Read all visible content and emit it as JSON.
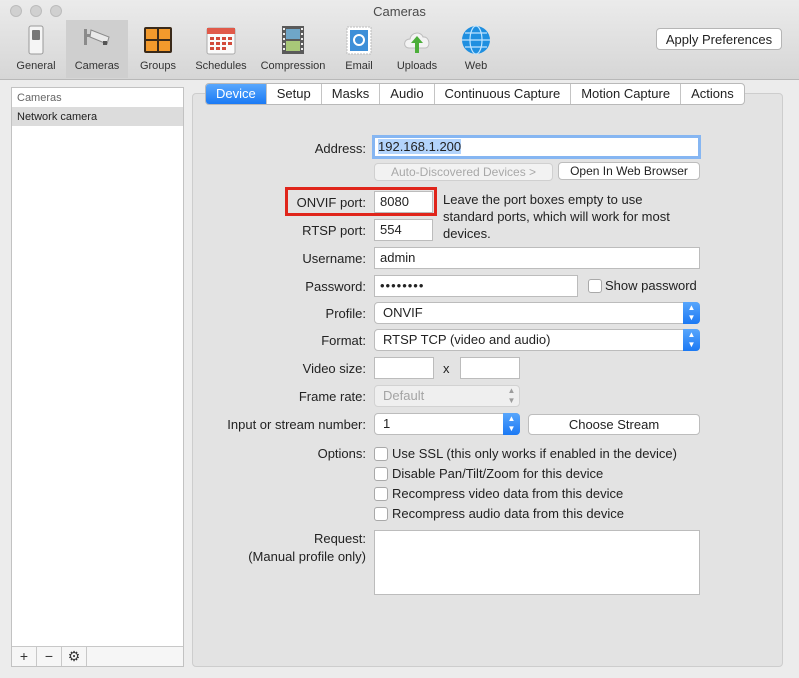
{
  "window": {
    "title": "Cameras"
  },
  "toolbar": {
    "items": [
      {
        "label": "General"
      },
      {
        "label": "Cameras"
      },
      {
        "label": "Groups"
      },
      {
        "label": "Schedules"
      },
      {
        "label": "Compression"
      },
      {
        "label": "Email"
      },
      {
        "label": "Uploads"
      },
      {
        "label": "Web"
      }
    ],
    "apply_label": "Apply Preferences"
  },
  "sidebar": {
    "header": "Cameras",
    "items": [
      {
        "label": "Network camera"
      }
    ],
    "footer": {
      "add": "+",
      "remove": "−",
      "settings": "⚙"
    }
  },
  "tabs": [
    "Device",
    "Setup",
    "Masks",
    "Audio",
    "Continuous Capture",
    "Motion Capture",
    "Actions"
  ],
  "form": {
    "address_label": "Address:",
    "address_value": "192.168.1.200",
    "auto_discovered_label": "Auto-Discovered Devices >",
    "open_browser_label": "Open In Web Browser",
    "onvif_label": "ONVIF port:",
    "onvif_value": "8080",
    "rtsp_label": "RTSP port:",
    "rtsp_value": "554",
    "port_hint": "Leave the port boxes empty to use standard ports, which will work for most devices.",
    "username_label": "Username:",
    "username_value": "admin",
    "password_label": "Password:",
    "password_value": "••••••••",
    "show_password_label": "Show password",
    "profile_label": "Profile:",
    "profile_value": "ONVIF",
    "format_label": "Format:",
    "format_value": "RTSP TCP (video and audio)",
    "video_size_label": "Video size:",
    "video_size_x": "x",
    "frame_rate_label": "Frame rate:",
    "frame_rate_value": "Default",
    "input_stream_label": "Input or stream number:",
    "input_stream_value": "1",
    "choose_stream_label": "Choose Stream",
    "options_label": "Options:",
    "options": [
      "Use SSL (this only works if enabled in the device)",
      "Disable Pan/Tilt/Zoom for this device",
      "Recompress video data from this device",
      "Recompress audio data from this device"
    ],
    "request_label_1": "Request:",
    "request_label_2": "(Manual profile only)"
  },
  "colors": {
    "accent": "#1a7af5",
    "highlight_box": "#e0251b"
  },
  "icons": {
    "general": "switch-icon",
    "cameras": "security-camera-icon",
    "groups": "grid-icon",
    "schedules": "calendar-icon",
    "compression": "film-icon",
    "email": "stamp-icon",
    "uploads": "cloud-upload-icon",
    "web": "globe-icon"
  }
}
